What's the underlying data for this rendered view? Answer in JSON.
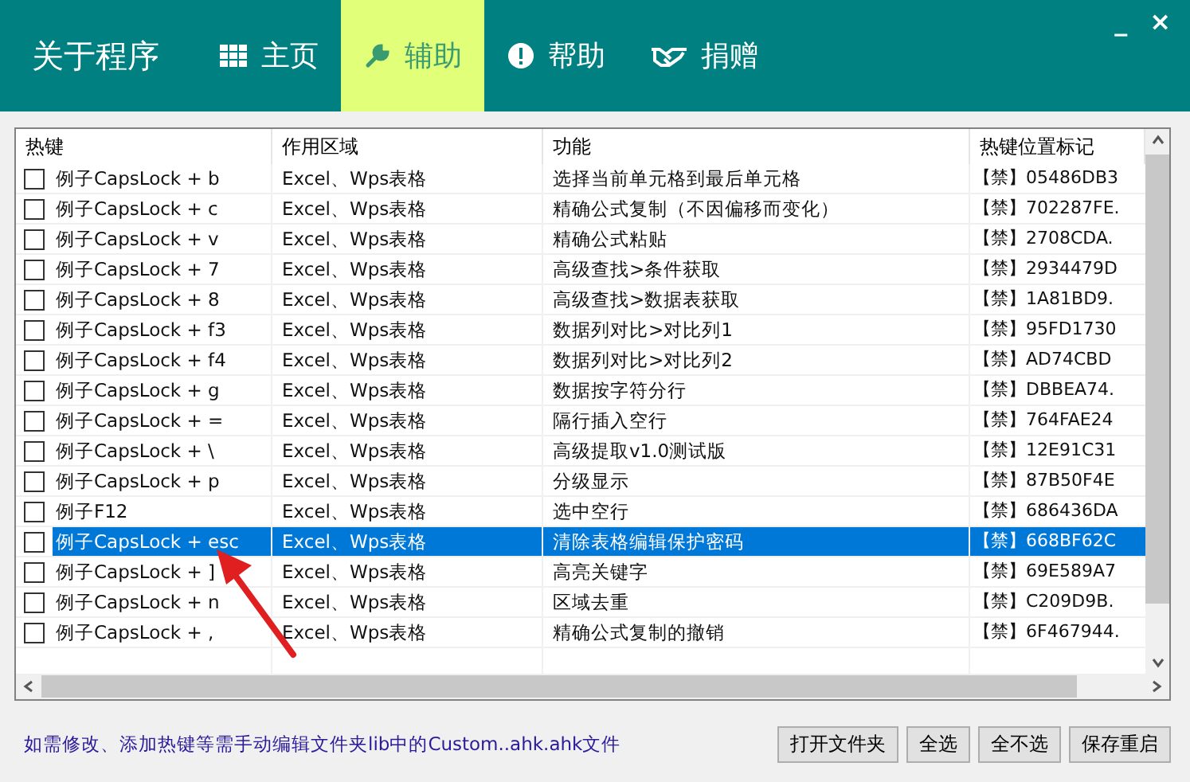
{
  "app_title": "关于程序",
  "window_controls": {
    "minimize": "_",
    "close": "×"
  },
  "tabs": [
    {
      "label": "主页",
      "selected": false
    },
    {
      "label": "辅助",
      "selected": true
    },
    {
      "label": "帮助",
      "selected": false
    },
    {
      "label": "捐赠",
      "selected": false
    }
  ],
  "table": {
    "columns": [
      "热键",
      "作用区域",
      "功能",
      "热键位置标记"
    ],
    "rows": [
      {
        "hotkey": "例子CapsLock + b",
        "scope": "Excel、Wps表格",
        "function": "选择当前单元格到最后单元格",
        "mark": "【禁】05486DB3",
        "checked": false,
        "selected": false
      },
      {
        "hotkey": "例子CapsLock + c",
        "scope": "Excel、Wps表格",
        "function": "精确公式复制（不因偏移而变化）",
        "mark": "【禁】702287FE.",
        "checked": false,
        "selected": false
      },
      {
        "hotkey": "例子CapsLock + v",
        "scope": "Excel、Wps表格",
        "function": "精确公式粘贴",
        "mark": "【禁】2708CDA.",
        "checked": false,
        "selected": false
      },
      {
        "hotkey": "例子CapsLock + 7",
        "scope": "Excel、Wps表格",
        "function": "高级查找>条件获取",
        "mark": "【禁】2934479D",
        "checked": false,
        "selected": false
      },
      {
        "hotkey": "例子CapsLock + 8",
        "scope": "Excel、Wps表格",
        "function": "高级查找>数据表获取",
        "mark": "【禁】1A81BD9.",
        "checked": false,
        "selected": false
      },
      {
        "hotkey": "例子CapsLock + f3",
        "scope": "Excel、Wps表格",
        "function": "数据列对比>对比列1",
        "mark": "【禁】95FD1730",
        "checked": false,
        "selected": false
      },
      {
        "hotkey": "例子CapsLock + f4",
        "scope": "Excel、Wps表格",
        "function": "数据列对比>对比列2",
        "mark": "【禁】AD74CBD",
        "checked": false,
        "selected": false
      },
      {
        "hotkey": "例子CapsLock + g",
        "scope": "Excel、Wps表格",
        "function": "数据按字符分行",
        "mark": "【禁】DBBEA74.",
        "checked": false,
        "selected": false
      },
      {
        "hotkey": "例子CapsLock + =",
        "scope": "Excel、Wps表格",
        "function": "隔行插入空行",
        "mark": "【禁】764FAE24",
        "checked": false,
        "selected": false
      },
      {
        "hotkey": "例子CapsLock + \\",
        "scope": "Excel、Wps表格",
        "function": "高级提取v1.0测试版",
        "mark": "【禁】12E91C31",
        "checked": false,
        "selected": false
      },
      {
        "hotkey": "例子CapsLock + p",
        "scope": "Excel、Wps表格",
        "function": "分级显示",
        "mark": "【禁】87B50F4E",
        "checked": false,
        "selected": false
      },
      {
        "hotkey": "例子F12",
        "scope": "Excel、Wps表格",
        "function": "选中空行",
        "mark": "【禁】686436DA",
        "checked": false,
        "selected": false
      },
      {
        "hotkey": "例子CapsLock + esc",
        "scope": "Excel、Wps表格",
        "function": "清除表格编辑保护密码",
        "mark": "【禁】668BF62C",
        "checked": false,
        "selected": true
      },
      {
        "hotkey": "例子CapsLock + ]",
        "scope": "Excel、Wps表格",
        "function": "高亮关键字",
        "mark": "【禁】69E589A7",
        "checked": false,
        "selected": false
      },
      {
        "hotkey": "例子CapsLock + n",
        "scope": "Excel、Wps表格",
        "function": "区域去重",
        "mark": "【禁】C209D9B.",
        "checked": false,
        "selected": false
      },
      {
        "hotkey": "例子CapsLock + ,",
        "scope": "Excel、Wps表格",
        "function": "精确公式复制的撤销",
        "mark": "【禁】6F467944.",
        "checked": false,
        "selected": false
      }
    ]
  },
  "footer_note": "如需修改、添加热键等需手动编辑文件夹lib中的Custom..ahk.ahk文件",
  "buttons": [
    "打开文件夹",
    "全选",
    "全不选",
    "保存重启"
  ]
}
